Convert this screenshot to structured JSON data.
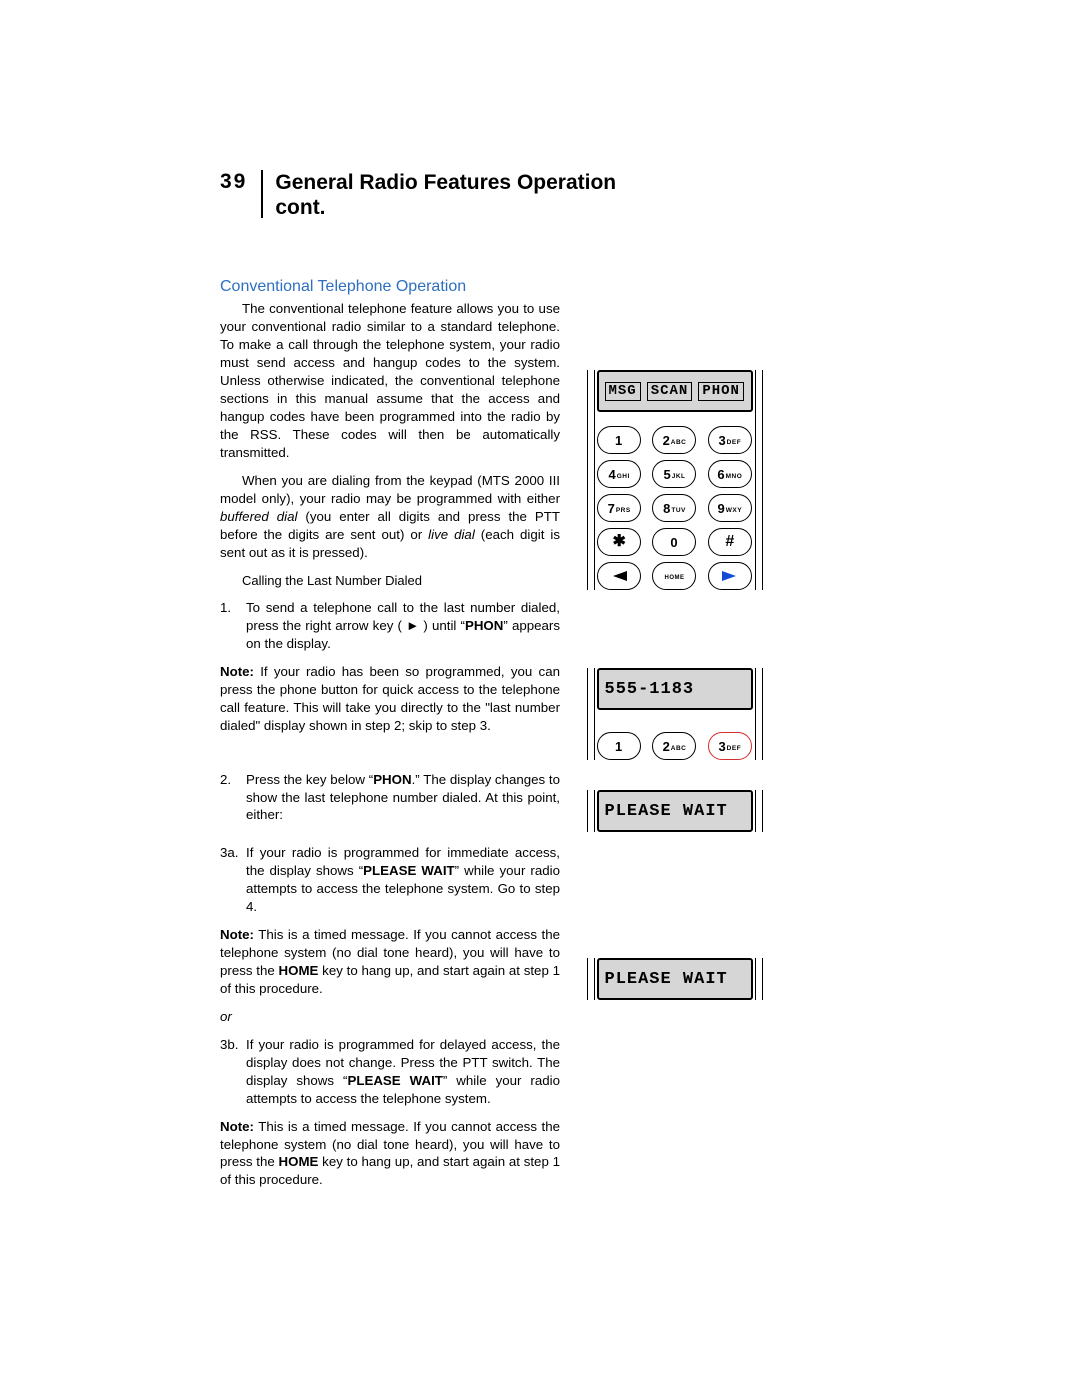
{
  "page": {
    "number": "39",
    "title_line1": "General Radio Features Operation",
    "title_line2": "cont."
  },
  "section": {
    "title": "Conventional Telephone Operation",
    "p1": "The conventional telephone feature allows you to use your conventional radio similar to a standard telephone. To make a call through the telephone system, your radio must send access and hangup codes to the system. Unless otherwise indicated, the conventional telephone sections in this manual assume that the access and hangup codes have been programmed into the radio by the RSS. These codes will then be automatically transmitted.",
    "p2a": "When you are dialing from the keypad (MTS 2000 III model only), your radio may be programmed with either ",
    "p2_em1": "buffered dial",
    "p2b": " (you enter all digits and press the PTT before the digits are sent out) or ",
    "p2_em2": "live dial",
    "p2c": " (each digit is sent out as it is pressed).",
    "sub1": "Calling the Last Number Dialed",
    "li1_num": "1.",
    "li1a": "To send a telephone call to the last number dialed, press the right arrow key ( ",
    "li1_arrow": "►",
    "li1b": " ) until “",
    "li1_phon": "PHON",
    "li1c": "” appears on the display.",
    "note1a": "Note:",
    "note1b": " If your radio has been so programmed, you can press the phone button for quick access to the telephone call feature. This will take you directly to the \"last number dialed\" display shown in step 2; skip to step 3.",
    "li2_num": "2.",
    "li2a": "Press the key below “",
    "li2_phon": "PHON",
    "li2b": ".” The display changes to show the last telephone number dialed. At this point, either:",
    "li3a_num": "3a.",
    "li3a_a": "If your radio is programmed for immediate access, the display shows “",
    "li3a_pw": "PLEASE WAIT",
    "li3a_b": "” while your radio attempts to access the telephone system. Go to step 4.",
    "note3a_a": "Note:",
    "note3a_b": " This is a timed message. If you cannot access the telephone system (no dial tone heard), you will have to press the ",
    "note3a_home": "HOME",
    "note3a_c": " key to hang up, and start again at step 1 of this procedure.",
    "or": "or",
    "li3b_num": "3b.",
    "li3b_a": "If your radio is programmed for delayed access, the display does not change. Press the PTT switch. The display shows “",
    "li3b_pw": "PLEASE WAIT",
    "li3b_b": "” while your radio attempts to access the telephone system.",
    "note3b_a": "Note:",
    "note3b_b": " This is a timed message. If you cannot access the telephone system (no dial tone heard), you will have to press the ",
    "note3b_home": "HOME",
    "note3b_c": " key to hang up, and start again at step 1 of this procedure."
  },
  "display1": {
    "soft1": "MSG",
    "soft2": "SCAN",
    "soft3": "PHON"
  },
  "keypad": {
    "k1": "1",
    "k2b": "2",
    "k2s": "ABC",
    "k3b": "3",
    "k3s": "DEF",
    "k4b": "4",
    "k4s": "GHI",
    "k5b": "5",
    "k5s": "JKL",
    "k6b": "6",
    "k6s": "MNO",
    "k7b": "7",
    "k7s": "PRS",
    "k8b": "8",
    "k8s": "TUV",
    "k9b": "9",
    "k9s": "WXY",
    "kstar": "✱",
    "k0": "0",
    "kpound": "#",
    "khome": "HOME"
  },
  "display2": {
    "text": "555-1183"
  },
  "display3": {
    "text": "PLEASE WAIT"
  },
  "display4": {
    "text": "PLEASE WAIT"
  }
}
